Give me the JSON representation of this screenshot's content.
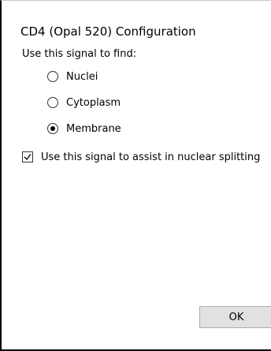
{
  "dialog": {
    "title": "CD4 (Opal 520) Configuration",
    "prompt": "Use this signal to find:",
    "options": [
      {
        "label": "Nuclei",
        "selected": false
      },
      {
        "label": "Cytoplasm",
        "selected": false
      },
      {
        "label": "Membrane",
        "selected": true
      }
    ],
    "assist_checkbox": {
      "label": "Use this signal to assist in nuclear splitting",
      "checked": true
    },
    "ok_label": "OK"
  }
}
